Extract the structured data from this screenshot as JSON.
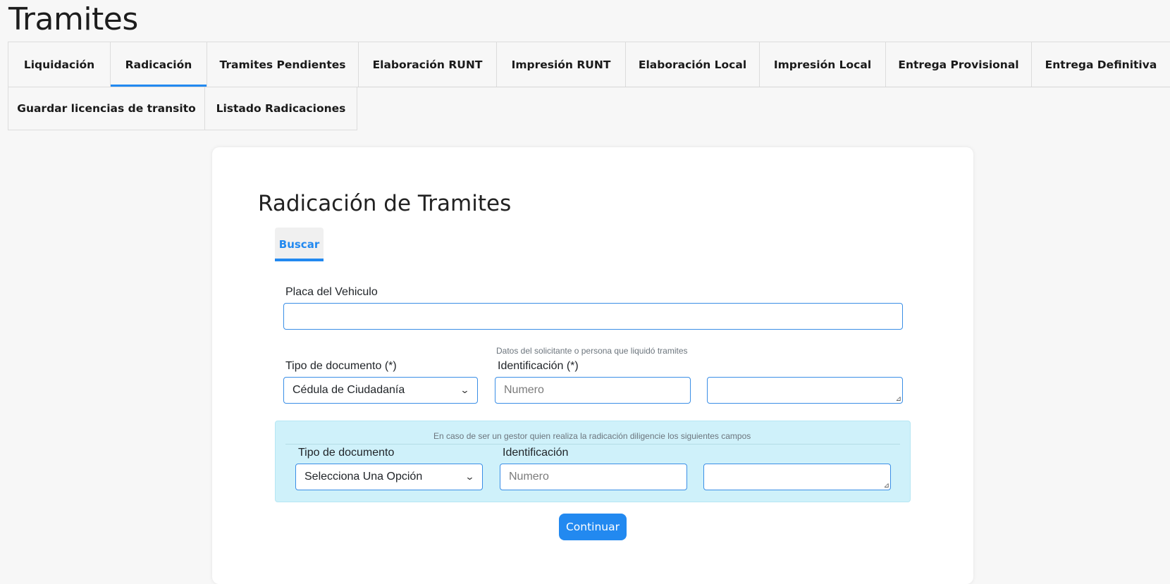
{
  "page": {
    "title": "Tramites"
  },
  "tabs": {
    "row1": [
      {
        "label": "Liquidación"
      },
      {
        "label": "Radicación"
      },
      {
        "label": "Tramites Pendientes"
      },
      {
        "label": "Elaboración RUNT"
      },
      {
        "label": "Impresión RUNT"
      },
      {
        "label": "Elaboración Local"
      },
      {
        "label": "Impresión Local"
      },
      {
        "label": "Entrega Provisional"
      },
      {
        "label": "Entrega Definitiva"
      }
    ],
    "row2": [
      {
        "label": "Guardar licencias de transito"
      },
      {
        "label": "Listado Radicaciones"
      }
    ],
    "active": "Radicación"
  },
  "form": {
    "title": "Radicación de Tramites",
    "subtab": "Buscar",
    "placa_label": "Placa del Vehiculo",
    "placa_value": "",
    "solicitante_hint": "Datos del solicitante o persona que liquidó tramites",
    "tipo_doc_label": "Tipo de documento (*)",
    "tipo_doc_value": "Cédula de Ciudadanía",
    "identificacion_label": "Identificación (*)",
    "identificacion_placeholder": "Numero",
    "gestor": {
      "hint": "En caso de ser un gestor quien realiza la radicación diligencie los siguientes campos",
      "tipo_doc_label": "Tipo de documento",
      "tipo_doc_value": "Selecciona Una Opción",
      "identificacion_label": "Identificación",
      "identificacion_placeholder": "Numero"
    },
    "continue_label": "Continuar"
  },
  "colors": {
    "accent": "#2289f0",
    "gestor_bg": "#cff1fa"
  }
}
